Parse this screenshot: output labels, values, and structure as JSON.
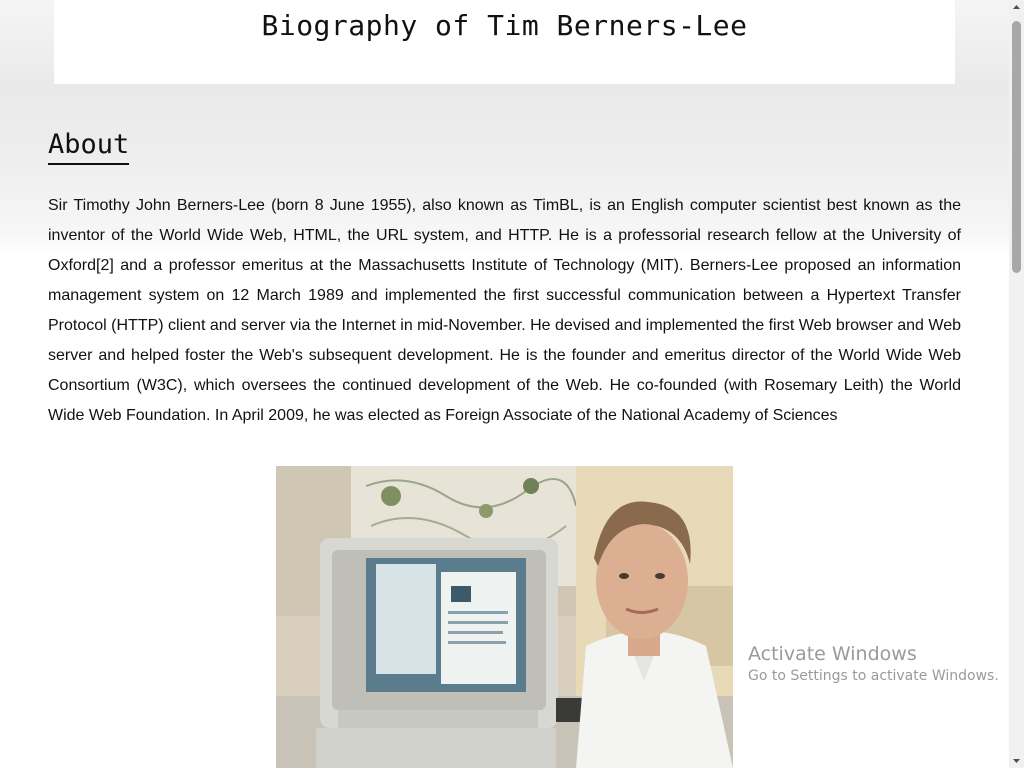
{
  "header": {
    "title": "Biography of Tim Berners-Lee"
  },
  "about": {
    "heading": "About",
    "paragraph": "Sir Timothy John Berners-Lee (born 8 June 1955), also known as TimBL, is an English computer scientist best known as the inventor of the World Wide Web, HTML, the URL system, and HTTP. He is a professorial research fellow at the University of Oxford[2] and a professor emeritus at the Massachusetts Institute of Technology (MIT). Berners-Lee proposed an information management system on 12 March 1989 and implemented the first successful communication between a Hypertext Transfer Protocol (HTTP) client and server via the Internet in mid-November. He devised and implemented the first Web browser and Web server and helped foster the Web's subsequent development. He is the founder and emeritus director of the World Wide Web Consortium (W3C), which oversees the continued development of the Web. He co-founded (with Rosemary Leith) the World Wide Web Foundation. In April 2009, he was elected as Foreign Associate of the National Academy of Sciences"
  },
  "photo": {
    "icon": "portrait-photo"
  },
  "watermark": {
    "title": "Activate Windows",
    "subtitle": "Go to Settings to activate Windows."
  },
  "scrollbar": {
    "up_icon": "scroll-up-arrow-icon",
    "down_icon": "scroll-down-arrow-icon"
  }
}
